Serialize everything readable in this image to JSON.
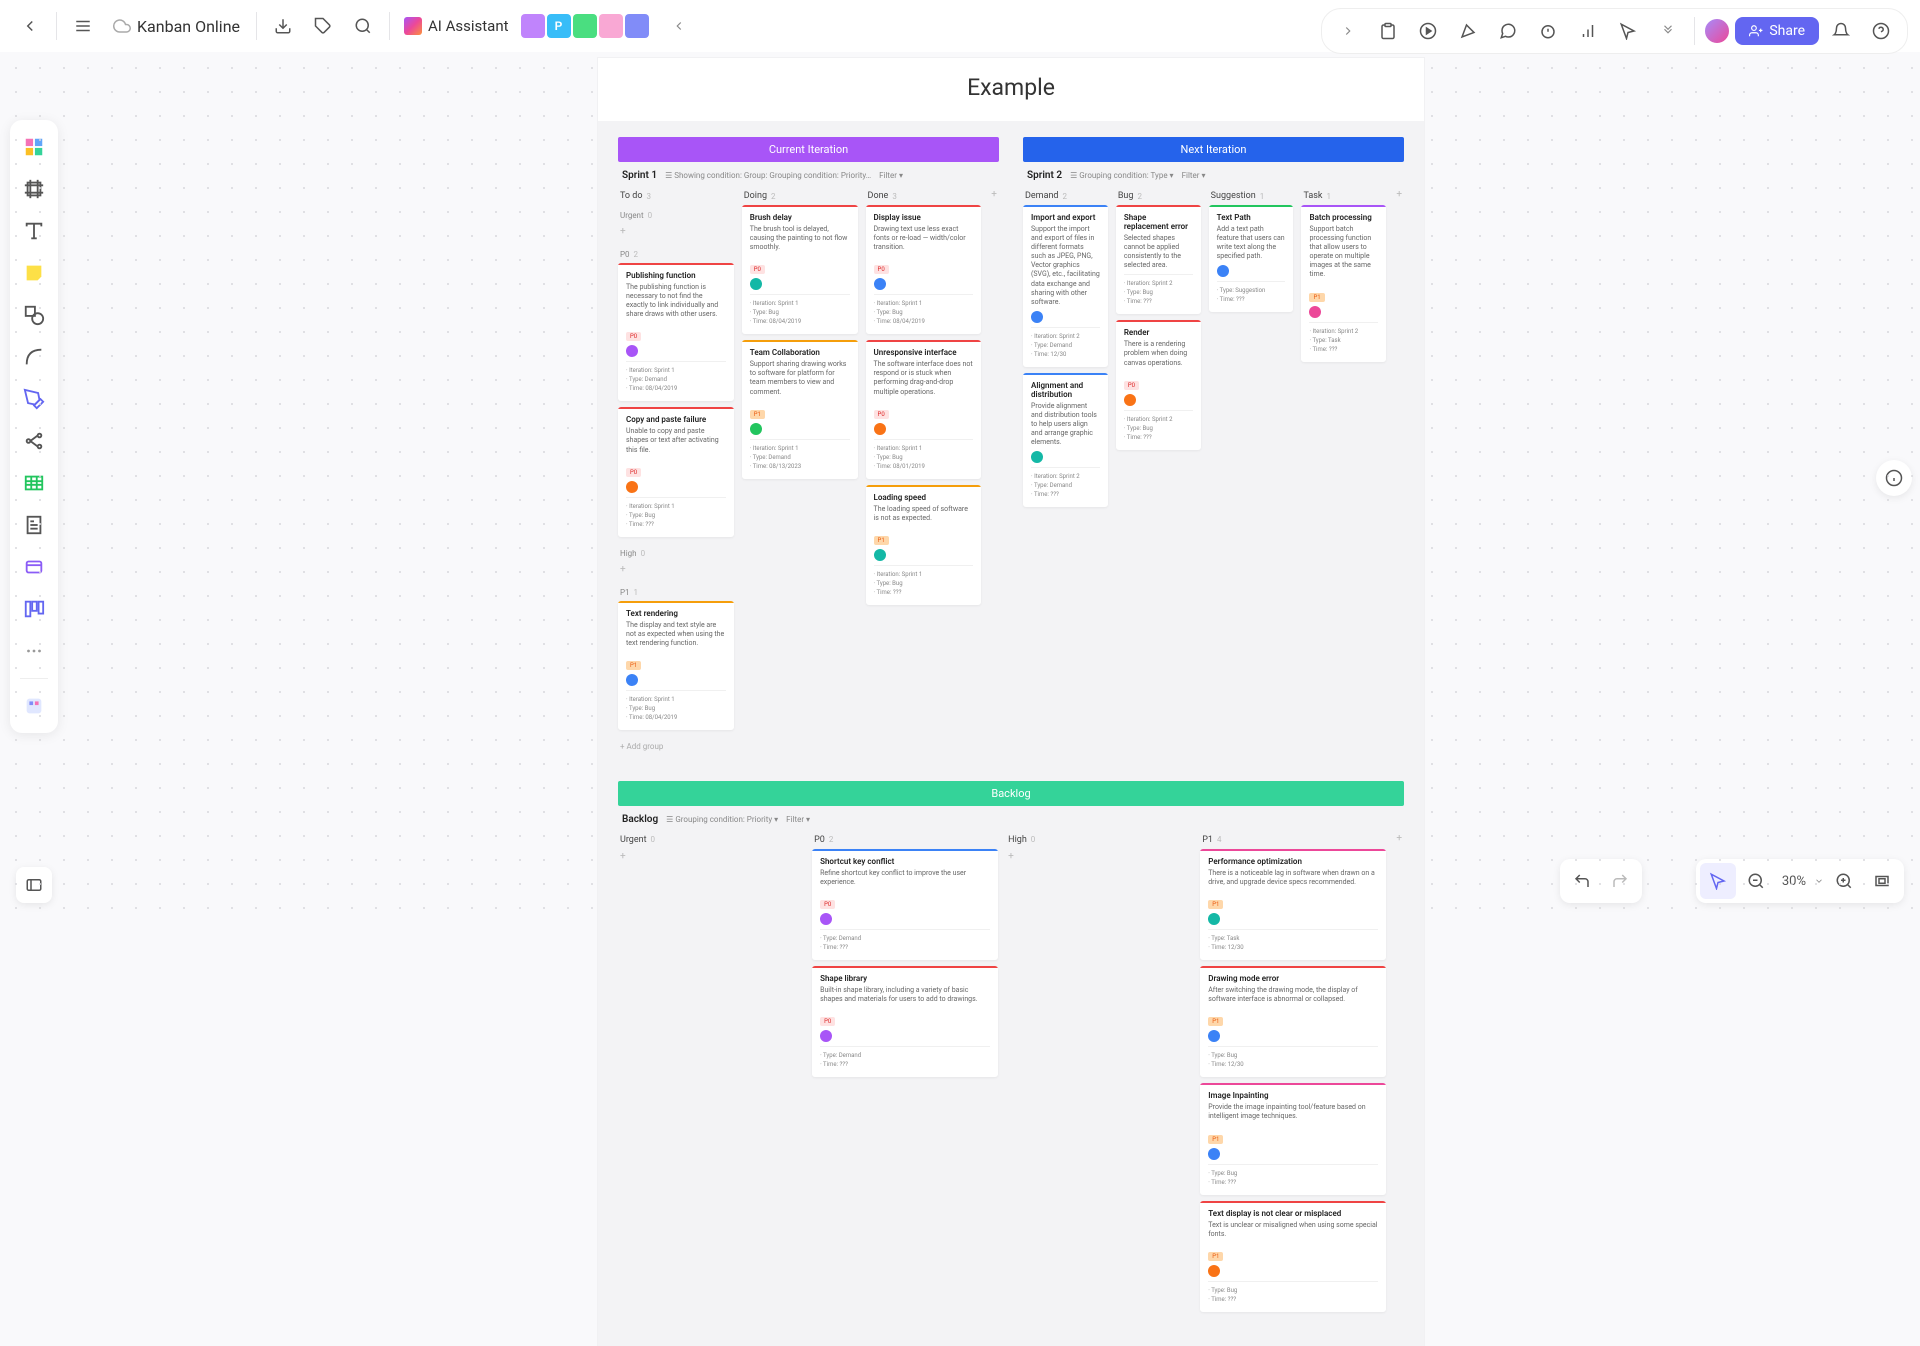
{
  "doc_title": "Kanban Online",
  "ai_label": "AI Assistant",
  "share_label": "Share",
  "zoom_label": "30%",
  "frame_title": "Example",
  "users": [
    {
      "initial": "",
      "bg": "#c084fc"
    },
    {
      "initial": "P",
      "bg": "#38bdf8"
    },
    {
      "initial": "",
      "bg": "#4ade80"
    },
    {
      "initial": "",
      "bg": "#f9a8d4"
    },
    {
      "initial": "",
      "bg": "#818cf8"
    }
  ],
  "iterations": [
    {
      "name": "Current Iteration",
      "color": "ih-purple",
      "sprint": "Sprint 1",
      "meta": "Showing condition: Group: Grouping condition: Priority…",
      "filter": "Filter ▾",
      "columns": [
        {
          "name": "To do",
          "count": "3",
          "groups": [
            {
              "label": "Urgent",
              "count": "0",
              "cards": []
            },
            {
              "label": "P0",
              "count": "2",
              "cards": [
                {
                  "stripe": "stripe-red",
                  "title": "Publishing function",
                  "desc": "The publishing function is necessary to not find the exactly to link individually and share draws with other users.",
                  "tag": "P0",
                  "tagc": "tag-red",
                  "avatar": "av-purple",
                  "meta": [
                    "Iteration: Sprint 1",
                    "Type: Demand",
                    "Time: 08/04/2019"
                  ]
                },
                {
                  "stripe": "stripe-red",
                  "title": "Copy and paste failure",
                  "desc": "Unable to copy and paste shapes or text after activating this file.",
                  "tag": "P0",
                  "tagc": "tag-red",
                  "avatar": "av-orange",
                  "meta": [
                    "Iteration: Sprint 1",
                    "Type: Bug",
                    "Time: ???"
                  ]
                }
              ]
            },
            {
              "label": "High",
              "count": "0",
              "cards": []
            },
            {
              "label": "P1",
              "count": "1",
              "cards": [
                {
                  "stripe": "stripe-orange",
                  "title": "Text rendering",
                  "desc": "The display and text style are not as expected when using the text rendering function.",
                  "tag": "P1",
                  "tagc": "tag-orange",
                  "avatar": "av-blue",
                  "meta": [
                    "Iteration: Sprint 1",
                    "Type: Bug",
                    "Time: 08/04/2019"
                  ]
                }
              ]
            }
          ]
        },
        {
          "name": "Doing",
          "count": "2",
          "groups": [
            {
              "label": "",
              "count": "",
              "cards": []
            },
            {
              "label": "",
              "count": "",
              "cards": [
                {
                  "stripe": "stripe-red",
                  "title": "Brush delay",
                  "desc": "The brush tool is delayed, causing the painting to not flow smoothly.",
                  "tag": "P0",
                  "tagc": "tag-red",
                  "avatar": "av-teal",
                  "meta": [
                    "Iteration: Sprint 1",
                    "Type: Bug",
                    "Time: 08/04/2019"
                  ]
                }
              ]
            },
            {
              "label": "",
              "count": "",
              "cards": []
            },
            {
              "label": "",
              "count": "",
              "cards": [
                {
                  "stripe": "stripe-orange",
                  "title": "Team Collaboration",
                  "desc": "Support sharing drawing works to software for platform for team members to view and comment.",
                  "tag": "P1",
                  "tagc": "tag-orange",
                  "avatar": "av-green",
                  "meta": [
                    "Iteration: Sprint 1",
                    "Type: Demand",
                    "Time: 08/13/2023"
                  ]
                }
              ]
            }
          ]
        },
        {
          "name": "Done",
          "count": "3",
          "groups": [
            {
              "label": "",
              "count": "",
              "cards": []
            },
            {
              "label": "",
              "count": "",
              "cards": [
                {
                  "stripe": "stripe-red",
                  "title": "Display issue",
                  "desc": "Drawing text use less exact fonts or re-load — width/color transition.",
                  "tag": "P0",
                  "tagc": "tag-red",
                  "avatar": "av-blue",
                  "meta": [
                    "Iteration: Sprint 1",
                    "Type: Bug",
                    "Time: 08/04/2019"
                  ]
                },
                {
                  "stripe": "stripe-red",
                  "title": "Unresponsive interface",
                  "desc": "The software interface does not respond or is stuck when performing drag-and-drop multiple operations.",
                  "tag": "P0",
                  "tagc": "tag-red",
                  "avatar": "av-orange",
                  "meta": [
                    "Iteration: Sprint 1",
                    "Type: Bug",
                    "Time: 08/01/2019"
                  ]
                }
              ]
            },
            {
              "label": "",
              "count": "",
              "cards": []
            },
            {
              "label": "",
              "count": "",
              "cards": [
                {
                  "stripe": "stripe-orange",
                  "title": "Loading speed",
                  "desc": "The loading speed of software is not as expected.",
                  "tag": "P1",
                  "tagc": "tag-orange",
                  "avatar": "av-teal",
                  "meta": [
                    "Iteration: Sprint 1",
                    "Type: Bug",
                    "Time: ???"
                  ]
                }
              ]
            }
          ]
        }
      ],
      "add_group": "+ Add group"
    },
    {
      "name": "Next Iteration",
      "color": "ih-blue",
      "sprint": "Sprint 2",
      "meta": "Grouping condition: Type ▾",
      "filter": "Filter ▾",
      "columns": [
        {
          "name": "Demand",
          "count": "2",
          "groups": [
            {
              "label": "",
              "count": "",
              "cards": [
                {
                  "stripe": "stripe-blue",
                  "title": "Import and export",
                  "desc": "Support the import and export of files in different formats such as JPEG, PNG, Vector graphics (SVG), etc., facilitating data exchange and sharing with other software.",
                  "tag": "",
                  "tagc": "",
                  "avatar": "av-blue",
                  "meta": [
                    "Iteration: Sprint 2",
                    "Type: Demand",
                    "Time: 12/30"
                  ]
                },
                {
                  "stripe": "stripe-blue",
                  "title": "Alignment and distribution",
                  "desc": "Provide alignment and distribution tools to help users align and arrange graphic elements.",
                  "tag": "",
                  "tagc": "",
                  "avatar": "av-teal",
                  "meta": [
                    "Iteration: Sprint 2",
                    "Type: Demand",
                    "Time: ???"
                  ]
                }
              ]
            }
          ]
        },
        {
          "name": "Bug",
          "count": "2",
          "groups": [
            {
              "label": "",
              "count": "",
              "cards": [
                {
                  "stripe": "stripe-red",
                  "title": "Shape replacement error",
                  "desc": "Selected shapes cannot be applied consistently to the selected area.",
                  "tag": "",
                  "tagc": "",
                  "avatar": "",
                  "meta": [
                    "Iteration: Sprint 2",
                    "Type: Bug",
                    "Time: ???"
                  ]
                },
                {
                  "stripe": "stripe-red",
                  "title": "Render",
                  "desc": "There is a rendering problem when doing canvas operations.",
                  "tag": "P0",
                  "tagc": "tag-red",
                  "avatar": "av-orange",
                  "meta": [
                    "Iteration: Sprint 2",
                    "Type: Bug",
                    "Time: ???"
                  ]
                }
              ]
            }
          ]
        },
        {
          "name": "Suggestion",
          "count": "1",
          "groups": [
            {
              "label": "",
              "count": "",
              "cards": [
                {
                  "stripe": "stripe-green",
                  "title": "Text Path",
                  "desc": "Add a text path feature that users can write text along the specified path.",
                  "tag": "",
                  "tagc": "",
                  "avatar": "av-blue",
                  "meta": [
                    "Type: Suggestion",
                    "Time: ???"
                  ]
                }
              ]
            }
          ]
        },
        {
          "name": "Task",
          "count": "1",
          "groups": [
            {
              "label": "",
              "count": "",
              "cards": [
                {
                  "stripe": "stripe-purple",
                  "title": "Batch processing",
                  "desc": "Support batch processing function that allow users to operate on multiple images at the same time.",
                  "tag": "P1",
                  "tagc": "tag-orange",
                  "avatar": "av-pink",
                  "meta": [
                    "Iteration: Sprint 2",
                    "Type: Task",
                    "Time: ???"
                  ]
                }
              ]
            }
          ]
        }
      ]
    }
  ],
  "backlog": {
    "name": "Backlog",
    "color": "ih-green",
    "sprint": "Backlog",
    "meta": "Grouping condition: Priority ▾",
    "filter": "Filter ▾",
    "columns": [
      {
        "name": "Urgent",
        "count": "0",
        "cards": []
      },
      {
        "name": "P0",
        "count": "2",
        "cards": [
          {
            "stripe": "stripe-blue",
            "title": "Shortcut key conflict",
            "desc": "Refine shortcut key conflict to improve the user experience.",
            "tag": "P0",
            "tagc": "tag-red",
            "avatar": "av-purple",
            "meta": [
              "Type: Demand",
              "Time: ???"
            ]
          },
          {
            "stripe": "stripe-red",
            "title": "Shape library",
            "desc": "Built-in shape library, including a variety of basic shapes and materials for users to add to drawings.",
            "tag": "P0",
            "tagc": "tag-red",
            "avatar": "av-purple",
            "meta": [
              "Type: Demand",
              "Time: ???"
            ]
          }
        ]
      },
      {
        "name": "High",
        "count": "0",
        "cards": []
      },
      {
        "name": "P1",
        "count": "4",
        "cards": [
          {
            "stripe": "stripe-pink",
            "title": "Performance optimization",
            "desc": "There is a noticeable lag in software when drawn on a drive, and upgrade device specs recommended.",
            "tag": "P1",
            "tagc": "tag-orange",
            "avatar": "av-teal",
            "meta": [
              "Type: Task",
              "Time: 12/30"
            ]
          },
          {
            "stripe": "stripe-red",
            "title": "Drawing mode error",
            "desc": "After switching the drawing mode, the display of software interface is abnormal or collapsed.",
            "tag": "P1",
            "tagc": "tag-orange",
            "avatar": "av-blue",
            "meta": [
              "Type: Bug",
              "Time: 12/30"
            ]
          },
          {
            "stripe": "stripe-pink",
            "title": "Image Inpainting",
            "desc": "Provide the image inpainting tool/feature based on intelligent image techniques.",
            "tag": "P1",
            "tagc": "tag-orange",
            "avatar": "av-blue",
            "meta": [
              "Type: Bug",
              "Time: ???"
            ]
          },
          {
            "stripe": "stripe-red",
            "title": "Text display is not clear or misplaced",
            "desc": "Text is unclear or misaligned when using some special fonts.",
            "tag": "P1",
            "tagc": "tag-orange",
            "avatar": "av-orange",
            "meta": [
              "Type: Bug",
              "Time: ???"
            ]
          }
        ]
      }
    ]
  }
}
